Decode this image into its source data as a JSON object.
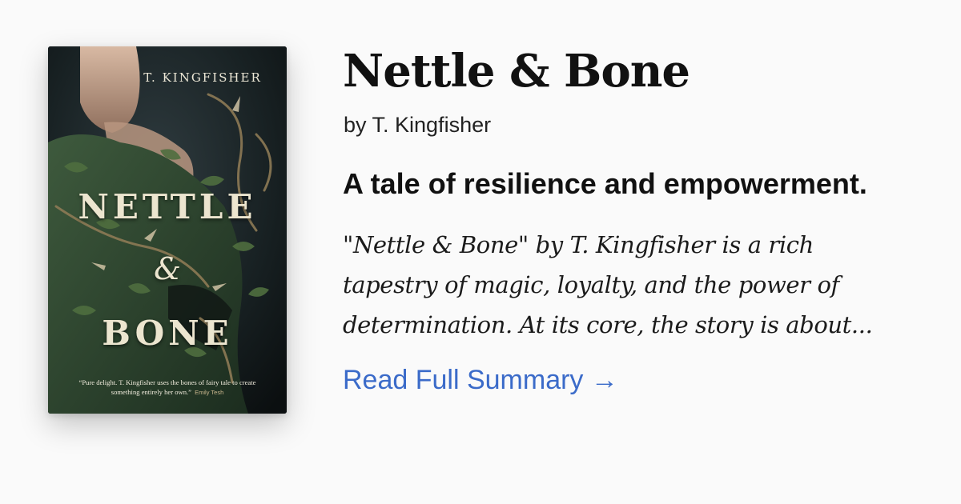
{
  "book": {
    "title": "Nettle & Bone",
    "author_line": "by T. Kingfisher",
    "tagline": "A tale of resilience and empowerment.",
    "summary_lines": [
      "\"Nettle & Bone\" by T. Kingfisher is a rich",
      "tapestry of magic, loyalty, and the power of",
      "determination. At its core, the story is about..."
    ],
    "read_more_label": "Read Full Summary →",
    "link_color": "#3b6bc9"
  },
  "cover": {
    "author": "T. KINGFISHER",
    "title_line_1": "NETTLE",
    "title_line_2": "&",
    "title_line_3": "BONE",
    "quote": "“Pure delight. T. Kingfisher uses the bones of fairy tale to create something entirely her own.”",
    "quote_attribution": "Emily Tesh"
  }
}
